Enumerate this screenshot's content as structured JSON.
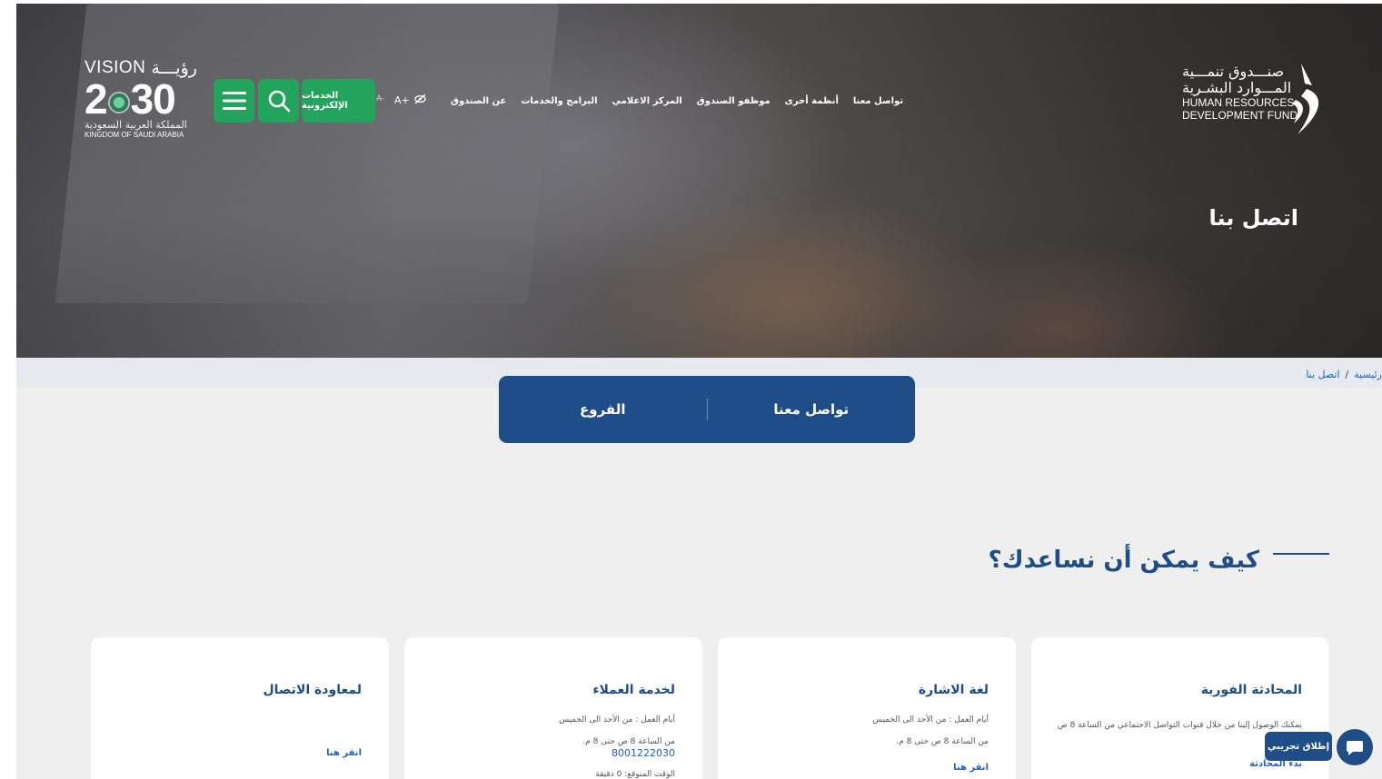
{
  "header": {
    "vision": {
      "vision_label": "VISION",
      "vision_ar": "رؤيـــة",
      "num_left": "2",
      "num_right": "30",
      "kingdom_ar": "المملكة العربية السعودية",
      "kingdom_en": "KINGDOM OF SAUDI ARABIA"
    },
    "eservices_label": "الخدمات الإلكترونية",
    "accessibility": {
      "font_small": "A-",
      "font_large": "A+"
    },
    "nav": [
      "عن الصندوق",
      "البرامج والخدمات",
      "المركز الاعلامي",
      "موظفو الصندوق",
      "أنظمة أخرى",
      "تواصل معنا"
    ],
    "logo": {
      "ar_line1": "صنـــدوق تنمـــية",
      "ar_line2": "المـــوارد البشـرية",
      "en_line1": "HUMAN RESOURCES",
      "en_line2": "DEVELOPMENT FUND"
    },
    "page_title": "اتصل بنا"
  },
  "breadcrumb": {
    "home": "رئيسية",
    "separator": "/",
    "current": "اتصل بنا"
  },
  "tabs": {
    "contact": "تواصل معنا",
    "branches": "الفروع"
  },
  "section_title": "كيف يمكن أن نساعدك؟",
  "cards": {
    "chat": {
      "title": "المحادثة الفورية",
      "desc": "يمكنك الوصول إلينا من خلال قنوات التواصل الاجتماعي من الساعة 8 ص",
      "desc2": "م",
      "link": "بدء المحادثة"
    },
    "sign": {
      "title": "لغة الاشارة",
      "days": "أيام العمل : من الأحد الى الخميس",
      "hours": "من الساعة 8 ص حتى 8 م.",
      "link": "انقر هنا"
    },
    "customer": {
      "title": "لخدمة العملاء",
      "days": "أيام العمل : من الأحد الى الخميس",
      "hours": "من الساعة 8 ص حتى 8 م.",
      "phone": "8001222030",
      "wait": "الوقت المتوقع: 0 دقيقة"
    },
    "callback": {
      "title": "لمعاودة الاتصال",
      "link": "انقر هنا"
    }
  },
  "chat_widget": {
    "label": "إطلاق تجريبي"
  },
  "colors": {
    "primary": "#1f4d87",
    "green": "#22a45d",
    "link": "#1f5fbf",
    "bg": "#efefef"
  }
}
